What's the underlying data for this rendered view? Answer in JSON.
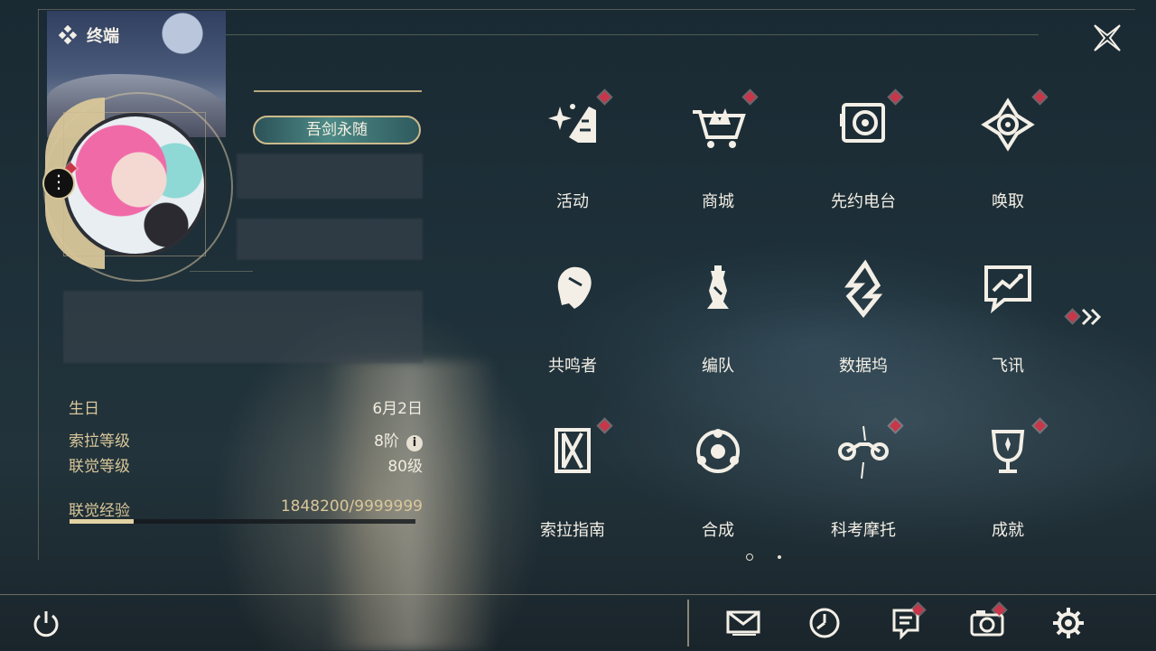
{
  "header": {
    "title": "终端"
  },
  "profile": {
    "title_badge": "吾剑永随",
    "info": [
      {
        "label": "生日",
        "value": "6月2日"
      },
      {
        "label": "索拉等级",
        "value": "8阶",
        "icon": "info-icon"
      },
      {
        "label": "联觉等级",
        "value": "80级"
      }
    ],
    "exp": {
      "label": "联觉经验",
      "value": "1848200/9999999",
      "fraction": 0.1848
    }
  },
  "menu": [
    {
      "id": "activity",
      "label": "活动",
      "icon": "activity-sparkle-icon",
      "badge": true
    },
    {
      "id": "shop",
      "label": "商城",
      "icon": "shop-cart-icon",
      "badge": true
    },
    {
      "id": "radio",
      "label": "先约电台",
      "icon": "radio-speaker-icon",
      "badge": true
    },
    {
      "id": "convene",
      "label": "唤取",
      "icon": "convene-compass-icon",
      "badge": true
    },
    {
      "id": "resonators",
      "label": "共鸣者",
      "icon": "resonator-head-icon",
      "badge": false
    },
    {
      "id": "team",
      "label": "编队",
      "icon": "chess-pieces-icon",
      "badge": false
    },
    {
      "id": "databank",
      "label": "数据坞",
      "icon": "databank-emblem-icon",
      "badge": false
    },
    {
      "id": "message",
      "label": "飞讯",
      "icon": "chat-bubble-icon",
      "badge": false
    },
    {
      "id": "guidebook",
      "label": "索拉指南",
      "icon": "guidebook-icon",
      "badge": true
    },
    {
      "id": "synthesis",
      "label": "合成",
      "icon": "synthesis-orbit-icon",
      "badge": false
    },
    {
      "id": "motorbike",
      "label": "科考摩托",
      "icon": "motorbike-icon",
      "badge": true
    },
    {
      "id": "achievements",
      "label": "成就",
      "icon": "trophy-icon",
      "badge": true
    }
  ],
  "bottom_bar": [
    {
      "id": "mail",
      "icon": "mail-icon",
      "badge": false
    },
    {
      "id": "schedule",
      "icon": "clock-icon",
      "badge": false
    },
    {
      "id": "notice",
      "icon": "notice-board-icon",
      "badge": true
    },
    {
      "id": "photo",
      "icon": "camera-icon",
      "badge": true
    },
    {
      "id": "settings",
      "icon": "gear-icon",
      "badge": false
    }
  ],
  "colors": {
    "accent_gold": "#d9c79a",
    "badge_red": "#c8364a",
    "text": "#f3efe6"
  }
}
